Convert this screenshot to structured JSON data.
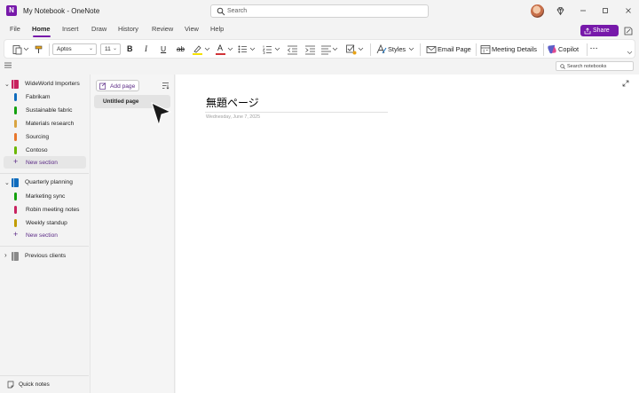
{
  "app": {
    "logo": "N",
    "window_title": "My Notebook - OneNote",
    "search_placeholder": "Search",
    "share_label": "Share",
    "window_controls": [
      "minimize-icon",
      "maximize-icon",
      "close-icon"
    ]
  },
  "menu_tabs": [
    {
      "label": "File"
    },
    {
      "label": "Home"
    },
    {
      "label": "Insert"
    },
    {
      "label": "Draw"
    },
    {
      "label": "History"
    },
    {
      "label": "Review"
    },
    {
      "label": "View"
    },
    {
      "label": "Help"
    }
  ],
  "active_tab": "Home",
  "ribbon": {
    "font_name": "Aptos",
    "font_size": "11",
    "bold": "B",
    "italic": "I",
    "underline": "U",
    "strikethrough": "ab",
    "font_color_letter": "A",
    "styles_label": "Styles",
    "email_page_label": "Email Page",
    "meeting_details_label": "Meeting Details",
    "copilot_label": "Copilot",
    "more_label": "...",
    "accent_colors": {
      "highlight": "#f5e102",
      "font_color": "#d13438",
      "brand": "#7719aa"
    }
  },
  "notebook_search_placeholder": "Search notebooks",
  "notebooks": [
    {
      "name": "WideWorld Importers",
      "color": "#c8235f",
      "expanded": true,
      "sections": [
        {
          "label": "Fabrikam",
          "color": "#0f6cbd"
        },
        {
          "label": "Sustainable fabric",
          "color": "#13a10e"
        },
        {
          "label": "Materials research",
          "color": "#e67e22"
        },
        {
          "label": "Sourcing",
          "color": "#e8762b"
        },
        {
          "label": "Contoso",
          "color": "#6bb700"
        }
      ],
      "new_section_label": "New section"
    },
    {
      "name": "Quarterly planning",
      "color": "#0f6cbd",
      "expanded": true,
      "sections": [
        {
          "label": "Marketing sync",
          "color": "#13a10e"
        },
        {
          "label": "Robin meeting notes",
          "color": "#c8235f"
        },
        {
          "label": "Weekly standup",
          "color": "#c19c00"
        }
      ],
      "new_section_label": "New section"
    },
    {
      "name": "Previous clients",
      "color": "#8a8a8a",
      "expanded": false,
      "sections": []
    }
  ],
  "quick_notes_label": "Quick notes",
  "pages": {
    "add_page_label": "Add page",
    "items": [
      {
        "label": "Untitled page"
      }
    ]
  },
  "page": {
    "title": "無題ページ",
    "date": "Wednesday, June 7, 2025"
  }
}
